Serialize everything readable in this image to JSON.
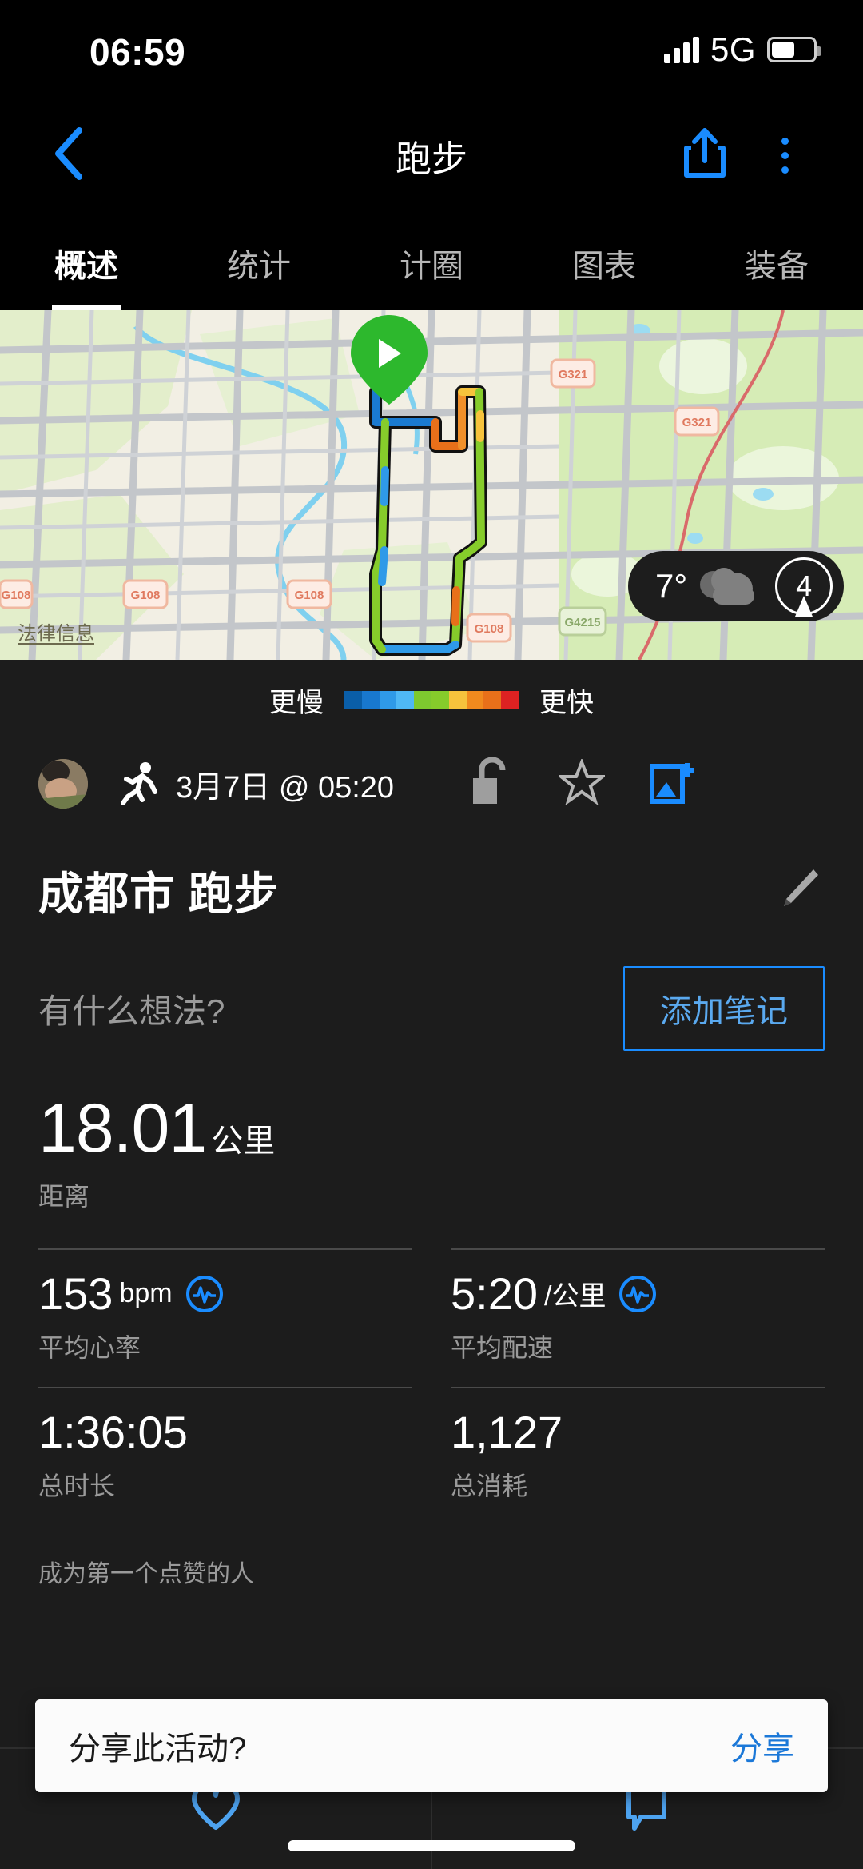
{
  "status_bar": {
    "time": "06:59",
    "network": "5G",
    "signal_icon": "cellular-bars-icon",
    "battery_icon": "battery-icon"
  },
  "nav": {
    "back_icon": "chevron-left-icon",
    "title": "跑步",
    "share_icon": "share-icon",
    "more_icon": "more-vertical-icon",
    "accent": "#1a8cff"
  },
  "tabs": [
    {
      "label": "概述",
      "active": true
    },
    {
      "label": "统计",
      "active": false
    },
    {
      "label": "计圈",
      "active": false
    },
    {
      "label": "图表",
      "active": false
    },
    {
      "label": "装备",
      "active": false
    }
  ],
  "map": {
    "legal_label": "法律信息",
    "start_marker_icon": "start-play-marker-icon",
    "weather": {
      "temperature": "7°",
      "condition_icon": "cloudy-icon",
      "compass_value": "4",
      "compass_icon": "compass-icon"
    }
  },
  "legend": {
    "slower_label": "更慢",
    "faster_label": "更快",
    "colors": [
      "#0a5ea8",
      "#1878cf",
      "#2f9ae8",
      "#4fb8f5",
      "#7ec92f",
      "#86cc2b",
      "#f6c33c",
      "#f08a1e",
      "#e8701a",
      "#dd2222"
    ]
  },
  "activity_meta": {
    "avatar_icon": "avatar",
    "sport_icon": "running-icon",
    "date": "3月7日 @ 05:20",
    "privacy_icon": "unlock-icon",
    "favorite_icon": "star-outline-icon",
    "add_photo_icon": "add-photo-icon"
  },
  "activity": {
    "title": "成都市 跑步",
    "edit_icon": "pencil-icon",
    "note_placeholder": "有什么想法?",
    "add_note_label": "添加笔记"
  },
  "primary_stat": {
    "value": "18.01",
    "unit": "公里",
    "label": "距离"
  },
  "stats": [
    {
      "value": "153",
      "unit": "bpm",
      "label": "平均心率",
      "badge_icon": "heartrate-waveform-icon"
    },
    {
      "value": "5:20",
      "unit": "/公里",
      "label": "平均配速",
      "badge_icon": "pace-waveform-icon"
    },
    {
      "value": "1:36:05",
      "unit": "",
      "label": "总时长",
      "badge_icon": ""
    },
    {
      "value": "1,127",
      "unit": "",
      "label": "总消耗",
      "badge_icon": ""
    }
  ],
  "social": {
    "like_hint": "成为第一个点赞的人",
    "like_icon": "heart-outline-icon",
    "comment_icon": "comment-bubble-icon"
  },
  "snackbar": {
    "message": "分享此活动?",
    "action_label": "分享",
    "action_color": "#1b78d8"
  }
}
